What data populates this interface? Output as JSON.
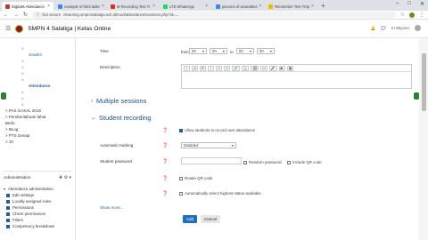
{
  "browser": {
    "tabs": [
      {
        "label": "Digitalis Attendance",
        "active": true,
        "color": "#c0392b"
      },
      {
        "label": "example of html table",
        "active": false,
        "color": "#4285f4"
      },
      {
        "label": "M Recording Test Tr",
        "active": false,
        "color": "#d93025"
      },
      {
        "label": "LTE WhatsApp",
        "active": false,
        "color": "#25d366"
      },
      {
        "label": "pictures of wearables",
        "active": false,
        "color": "#4285f4"
      },
      {
        "label": "Remember Test Tmp",
        "active": false,
        "color": "#f4b400"
      }
    ],
    "new_tab": "+",
    "window_controls": [
      "–",
      "□",
      "✕"
    ],
    "url_prefix": "Not secure",
    "url": "elearning.smpn4salatiga.sch.id/mod/attendance/sessions.php?id=..."
  },
  "site": {
    "name": "SMPN 4 Salatiga | Kelas Online",
    "user": "Iri Wiyono"
  },
  "sidebar": {
    "nav": [
      {
        "label": "o",
        "style": "plain"
      },
      {
        "label": "Grades",
        "style": "link"
      },
      {
        "label": "o",
        "style": "plain"
      },
      {
        "label": "o",
        "style": "plain"
      },
      {
        "label": "o",
        "style": "plain"
      },
      {
        "label": "o",
        "style": "plain"
      },
      {
        "label": "Attendance",
        "style": "bold"
      },
      {
        "label": "o",
        "style": "plain"
      },
      {
        "label": "o",
        "style": "plain"
      },
      {
        "label": "o",
        "style": "plain"
      },
      {
        "label": "> PAS GASAL 2019",
        "style": "plain"
      },
      {
        "label": "> Pemberitahuan lahat",
        "style": "plain"
      },
      {
        "label": "Berbi",
        "style": "plain"
      },
      {
        "label": "> BLog",
        "style": "plain"
      },
      {
        "label": "> PTS Genap",
        "style": "plain"
      },
      {
        "label": "> 10",
        "style": "plain"
      }
    ],
    "admin_title": "Administration",
    "admin_items": [
      "Attendance administration",
      "Edit settings",
      "Locally assigned roles",
      "Permissions",
      "Check permissions",
      "Filters",
      "Competency breakdown"
    ]
  },
  "form": {
    "time_label": "Time",
    "time_from": "from",
    "time_to": "to",
    "time_values": [
      "00",
      "00",
      "00",
      "00"
    ],
    "description_label": "Description",
    "editor_buttons": [
      "i",
      "A",
      "B",
      "I",
      "≡",
      "≡",
      "🔗",
      "⚓",
      "🖼",
      "▭",
      "🎤",
      "▶",
      "▦"
    ],
    "section_multiple": "Multiple sessions",
    "section_student": "Student recording",
    "allow_students": "Allow students to record own attendance",
    "automatic_marking_label": "Automatic marking",
    "automatic_marking_value": "Disabled",
    "student_password_label": "Student password",
    "random_password": "Random password",
    "include_qr": "Include QR code",
    "rotate_qr": "Rotate QR code",
    "auto_select_status": "Automatically select highest status available",
    "show_more": "Show more...",
    "add_button": "Add",
    "cancel_button": "Cancel"
  }
}
